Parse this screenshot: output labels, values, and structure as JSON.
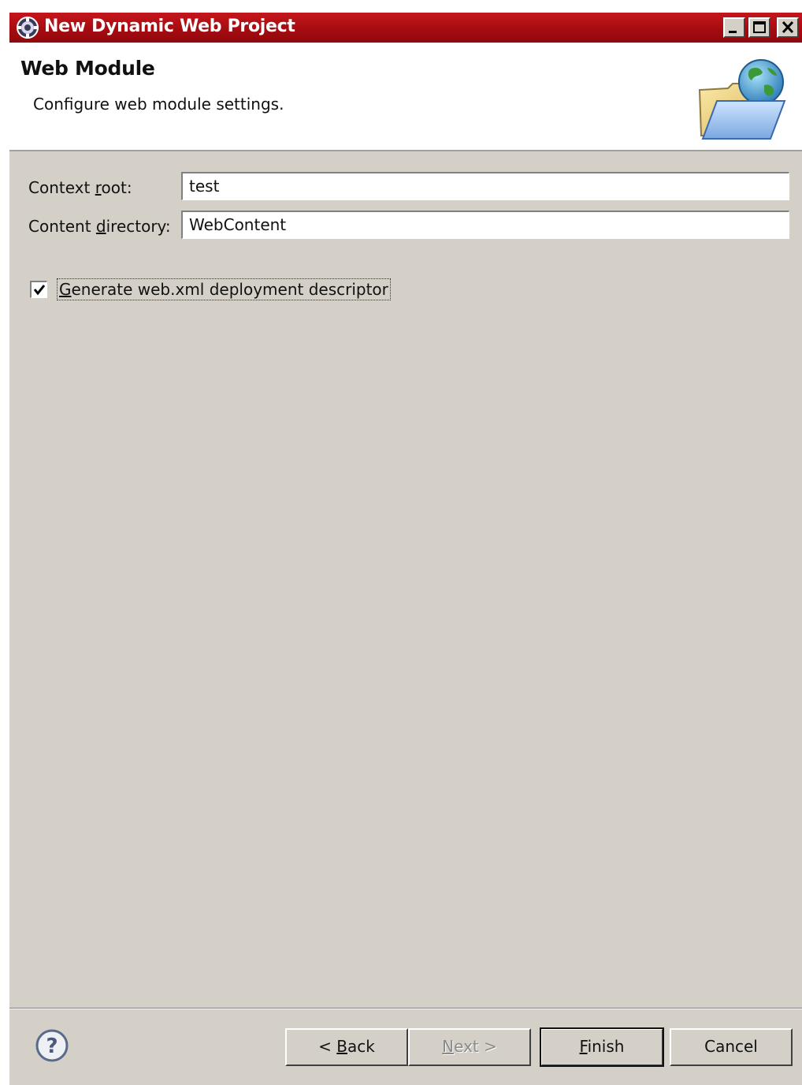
{
  "window": {
    "title": "New Dynamic Web Project",
    "icon": "eclipse-gear-icon"
  },
  "header": {
    "title": "Web Module",
    "description": "Configure web module settings.",
    "graphic": "folder-globe-icon"
  },
  "form": {
    "context_root": {
      "label_pre": "Context ",
      "label_mnemonic": "r",
      "label_post": "oot:",
      "value": "test"
    },
    "content_directory": {
      "label_pre": "Content ",
      "label_mnemonic": "d",
      "label_post": "irectory:",
      "value": "WebContent"
    },
    "generate_descriptor": {
      "checked": true,
      "label_mnemonic": "G",
      "label_post": "enerate web.xml deployment descriptor"
    }
  },
  "buttons": {
    "back": {
      "pre": "< ",
      "mnemonic": "B",
      "post": "ack",
      "enabled": true
    },
    "next": {
      "pre": "",
      "mnemonic": "N",
      "post": "ext >",
      "enabled": false
    },
    "finish": {
      "pre": "",
      "mnemonic": "F",
      "post": "inish",
      "enabled": true
    },
    "cancel": {
      "label": "Cancel",
      "enabled": true
    }
  },
  "help": {
    "icon": "help-icon"
  },
  "colors": {
    "titlebar": "#b0121a",
    "dialog_bg": "#d4d0c8",
    "header_bg": "#ffffff"
  }
}
